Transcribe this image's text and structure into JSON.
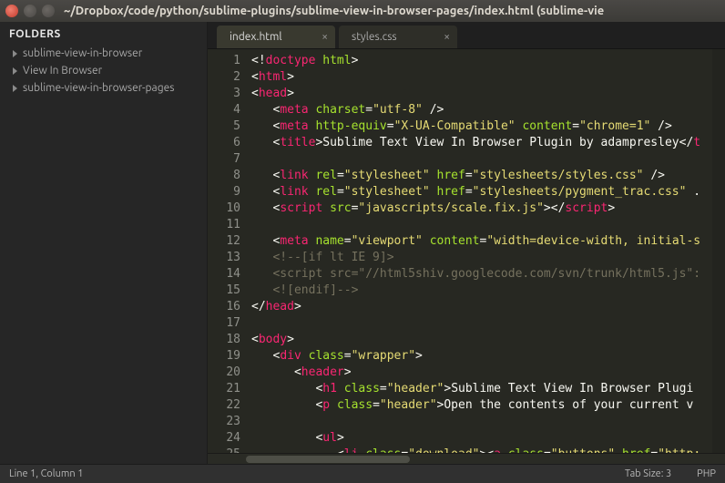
{
  "titlebar": {
    "title": "~/Dropbox/code/python/sublime-plugins/sublime-view-in-browser-pages/index.html (sublime-vie"
  },
  "sidebar": {
    "header": "FOLDERS",
    "items": [
      {
        "label": "sublime-view-in-browser"
      },
      {
        "label": "View In Browser"
      },
      {
        "label": "sublime-view-in-browser-pages"
      }
    ]
  },
  "tabs": [
    {
      "label": "index.html",
      "active": true
    },
    {
      "label": "styles.css",
      "active": false
    }
  ],
  "status": {
    "left": "Line 1, Column 1",
    "tabsize": "Tab Size: 3",
    "lang": "PHP"
  },
  "code_lines": [
    [
      [
        "pun",
        "<!"
      ],
      [
        "tag",
        "doctype"
      ],
      [
        "pun",
        " "
      ],
      [
        "attr",
        "html"
      ],
      [
        "pun",
        ">"
      ]
    ],
    [
      [
        "pun",
        "<"
      ],
      [
        "tag",
        "html"
      ],
      [
        "pun",
        ">"
      ]
    ],
    [
      [
        "pun",
        "<"
      ],
      [
        "tag",
        "head"
      ],
      [
        "pun",
        ">"
      ]
    ],
    [
      [
        "pun",
        "   <"
      ],
      [
        "tag",
        "meta"
      ],
      [
        "pun",
        " "
      ],
      [
        "attr",
        "charset"
      ],
      [
        "pun",
        "="
      ],
      [
        "str",
        "\"utf-8\""
      ],
      [
        "pun",
        " />"
      ]
    ],
    [
      [
        "pun",
        "   <"
      ],
      [
        "tag",
        "meta"
      ],
      [
        "pun",
        " "
      ],
      [
        "attr",
        "http-equiv"
      ],
      [
        "pun",
        "="
      ],
      [
        "str",
        "\"X-UA-Compatible\""
      ],
      [
        "pun",
        " "
      ],
      [
        "attr",
        "content"
      ],
      [
        "pun",
        "="
      ],
      [
        "str",
        "\"chrome=1\""
      ],
      [
        "pun",
        " />"
      ]
    ],
    [
      [
        "pun",
        "   <"
      ],
      [
        "tag",
        "title"
      ],
      [
        "pun",
        ">"
      ],
      [
        "txt",
        "Sublime Text View In Browser Plugin by adampresley"
      ],
      [
        "pun",
        "</"
      ],
      [
        "tag",
        "t"
      ]
    ],
    [],
    [
      [
        "pun",
        "   <"
      ],
      [
        "tag",
        "link"
      ],
      [
        "pun",
        " "
      ],
      [
        "attr",
        "rel"
      ],
      [
        "pun",
        "="
      ],
      [
        "str",
        "\"stylesheet\""
      ],
      [
        "pun",
        " "
      ],
      [
        "attr",
        "href"
      ],
      [
        "pun",
        "="
      ],
      [
        "str",
        "\"stylesheets/styles.css\""
      ],
      [
        "pun",
        " />"
      ]
    ],
    [
      [
        "pun",
        "   <"
      ],
      [
        "tag",
        "link"
      ],
      [
        "pun",
        " "
      ],
      [
        "attr",
        "rel"
      ],
      [
        "pun",
        "="
      ],
      [
        "str",
        "\"stylesheet\""
      ],
      [
        "pun",
        " "
      ],
      [
        "attr",
        "href"
      ],
      [
        "pun",
        "="
      ],
      [
        "str",
        "\"stylesheets/pygment_trac.css\""
      ],
      [
        "pun",
        " ."
      ]
    ],
    [
      [
        "pun",
        "   <"
      ],
      [
        "tag",
        "script"
      ],
      [
        "pun",
        " "
      ],
      [
        "attr",
        "src"
      ],
      [
        "pun",
        "="
      ],
      [
        "str",
        "\"javascripts/scale.fix.js\""
      ],
      [
        "pun",
        "></"
      ],
      [
        "tag",
        "script"
      ],
      [
        "pun",
        ">"
      ]
    ],
    [],
    [
      [
        "pun",
        "   <"
      ],
      [
        "tag",
        "meta"
      ],
      [
        "pun",
        " "
      ],
      [
        "attr",
        "name"
      ],
      [
        "pun",
        "="
      ],
      [
        "str",
        "\"viewport\""
      ],
      [
        "pun",
        " "
      ],
      [
        "attr",
        "content"
      ],
      [
        "pun",
        "="
      ],
      [
        "str",
        "\"width=device-width, initial-s"
      ]
    ],
    [
      [
        "com",
        "   <!--[if lt IE 9]>"
      ]
    ],
    [
      [
        "com",
        "   <script src=\"//html5shiv.googlecode.com/svn/trunk/html5.js\":"
      ]
    ],
    [
      [
        "com",
        "   <![endif]-->"
      ]
    ],
    [
      [
        "pun",
        "</"
      ],
      [
        "tag",
        "head"
      ],
      [
        "pun",
        ">"
      ]
    ],
    [],
    [
      [
        "pun",
        "<"
      ],
      [
        "tag",
        "body"
      ],
      [
        "pun",
        ">"
      ]
    ],
    [
      [
        "pun",
        "   <"
      ],
      [
        "tag",
        "div"
      ],
      [
        "pun",
        " "
      ],
      [
        "attr",
        "class"
      ],
      [
        "pun",
        "="
      ],
      [
        "str",
        "\"wrapper\""
      ],
      [
        "pun",
        ">"
      ]
    ],
    [
      [
        "pun",
        "      <"
      ],
      [
        "tag",
        "header"
      ],
      [
        "pun",
        ">"
      ]
    ],
    [
      [
        "pun",
        "         <"
      ],
      [
        "tag",
        "h1"
      ],
      [
        "pun",
        " "
      ],
      [
        "attr",
        "class"
      ],
      [
        "pun",
        "="
      ],
      [
        "str",
        "\"header\""
      ],
      [
        "pun",
        ">"
      ],
      [
        "txt",
        "Sublime Text View In Browser Plugi"
      ]
    ],
    [
      [
        "pun",
        "         <"
      ],
      [
        "tag",
        "p"
      ],
      [
        "pun",
        " "
      ],
      [
        "attr",
        "class"
      ],
      [
        "pun",
        "="
      ],
      [
        "str",
        "\"header\""
      ],
      [
        "pun",
        ">"
      ],
      [
        "txt",
        "Open the contents of your current v"
      ]
    ],
    [],
    [
      [
        "pun",
        "         <"
      ],
      [
        "tag",
        "ul"
      ],
      [
        "pun",
        ">"
      ]
    ],
    [
      [
        "pun",
        "            <"
      ],
      [
        "tag",
        "li"
      ],
      [
        "pun",
        " "
      ],
      [
        "attr",
        "class"
      ],
      [
        "pun",
        "="
      ],
      [
        "str",
        "\"download\""
      ],
      [
        "pun",
        "><"
      ],
      [
        "tag",
        "a"
      ],
      [
        "pun",
        " "
      ],
      [
        "attr",
        "class"
      ],
      [
        "pun",
        "="
      ],
      [
        "str",
        "\"buttons\""
      ],
      [
        "pun",
        " "
      ],
      [
        "attr",
        "href"
      ],
      [
        "pun",
        "="
      ],
      [
        "str",
        "\"http:"
      ]
    ]
  ]
}
